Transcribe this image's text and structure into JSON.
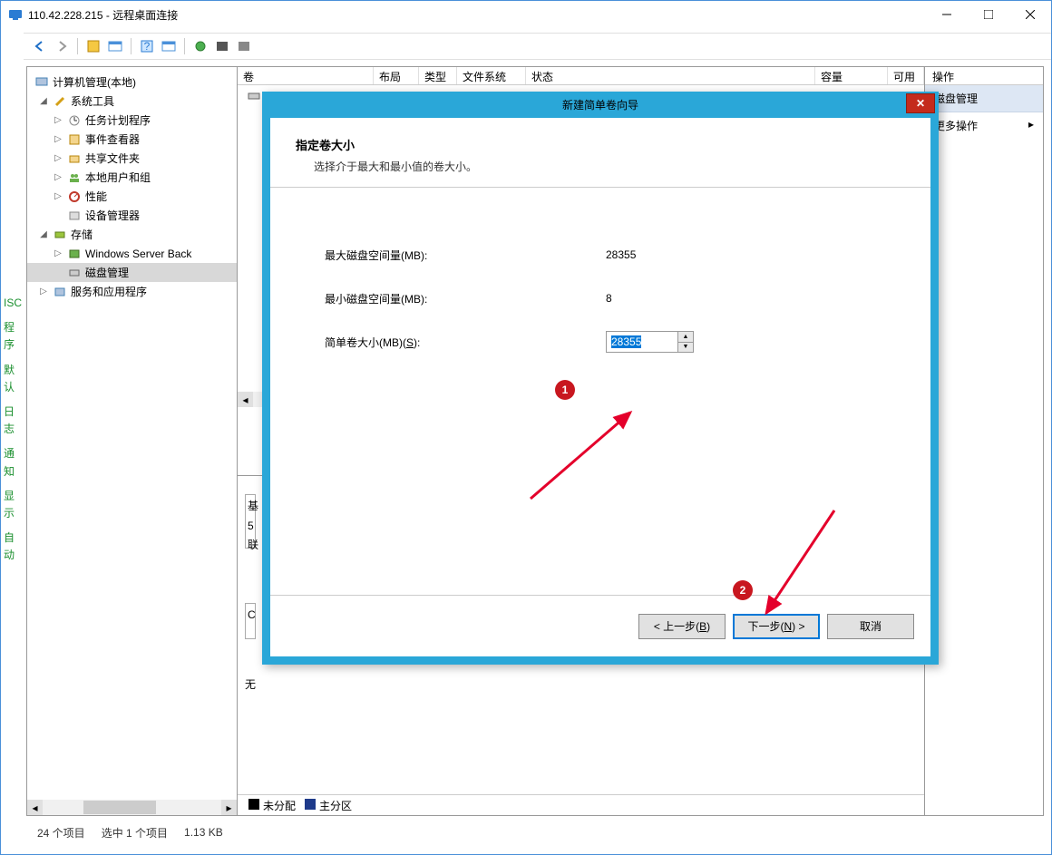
{
  "window": {
    "title": "110.42.228.215 - 远程桌面连接"
  },
  "tree": {
    "root": "计算机管理(本地)",
    "sys": "系统工具",
    "task": "任务计划程序",
    "event": "事件查看器",
    "share": "共享文件夹",
    "users": "本地用户和组",
    "perf": "性能",
    "devmgr": "设备管理器",
    "storage": "存储",
    "wsb": "Windows Server Back",
    "diskmgmt": "磁盘管理",
    "svc": "服务和应用程序"
  },
  "grid": {
    "c1": "卷",
    "c2": "布局",
    "c3": "类型",
    "c4": "文件系统",
    "c5": "状态",
    "c6": "容量",
    "c7": "可用",
    "c8": "操作"
  },
  "rp": {
    "row1": "磁盘管理",
    "row2": "更多操作"
  },
  "legend": {
    "a": "未分配",
    "b": "主分区"
  },
  "midtext": {
    "l1": "基",
    "l2": "5",
    "l3": "联",
    "c1": "C",
    "c2": "无"
  },
  "status": {
    "a": "24 个项目",
    "b": "选中 1 个项目",
    "c": "1.13 KB"
  },
  "sidecut": {
    "a": "ISC",
    "b": "程序",
    "c": "默认",
    "d": "日志",
    "e": "通知",
    "f": "显示",
    "g": "自动"
  },
  "wizard": {
    "title": "新建简单卷向导",
    "h": "指定卷大小",
    "sub": "选择介于最大和最小值的卷大小。",
    "max_l": "最大磁盘空间量(MB):",
    "max_v": "28355",
    "min_l": "最小磁盘空间量(MB):",
    "min_v": "8",
    "size_l_a": "简单卷大小(MB)(",
    "size_l_s": "S",
    "size_l_b": "):",
    "size_v": "28355",
    "back_a": "< 上一步(",
    "back_s": "B",
    "back_b": ")",
    "next_a": "下一步(",
    "next_s": "N",
    "next_b": ") >",
    "cancel": "取消"
  },
  "badge": {
    "one": "1",
    "two": "2"
  }
}
